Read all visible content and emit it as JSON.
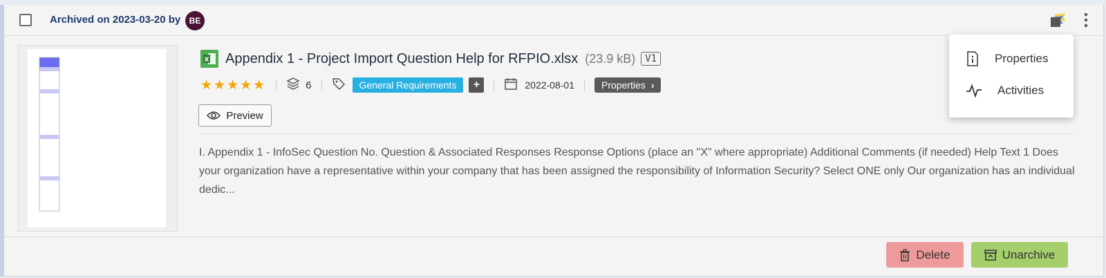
{
  "header": {
    "archived_text": "Archived on 2023-03-20 by",
    "avatar_initials": "BE"
  },
  "document": {
    "title": "Appendix 1 - Project Import Question Help for RFPIO.xlsx",
    "size": "(23.9 kB)",
    "version": "V1",
    "rating_stars": 5,
    "stars_display": "★★★★★",
    "layers_count": "6",
    "tag": "General Requirements",
    "add_tag_label": "+",
    "date": "2022-08-01",
    "properties_label": "Properties",
    "properties_chevron": "›",
    "preview_label": "Preview",
    "snippet": "I. Appendix 1 - InfoSec Question No. Question & Associated Responses Response Options (place an \"X\" where appropriate) Additional Comments (if needed) Help Text 1 Does your organization have a representative within your company that has been assigned the responsibility of Information Security? Select ONE only Our organization has an individual dedic..."
  },
  "menu": {
    "items": [
      {
        "label": "Properties",
        "icon": "info-doc-icon"
      },
      {
        "label": "Activities",
        "icon": "activity-icon"
      }
    ]
  },
  "footer": {
    "delete_label": "Delete",
    "unarchive_label": "Unarchive"
  },
  "colors": {
    "tag": "#29b0e3",
    "star": "#f5a500",
    "delete": "#ef9a9a",
    "unarchive": "#a5cf6a",
    "avatar": "#4a1235"
  }
}
